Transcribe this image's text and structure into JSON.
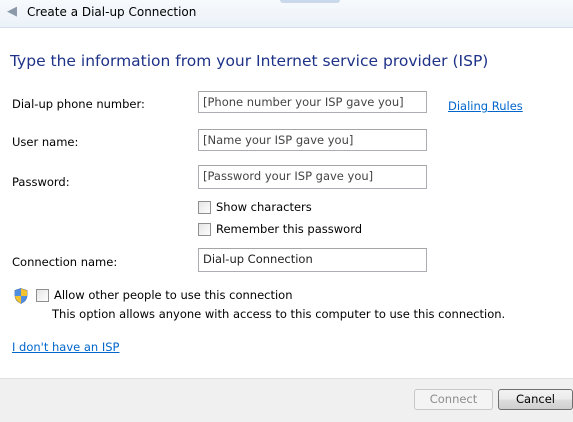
{
  "window": {
    "title": "Create a Dial-up Connection",
    "back_icon": "back-arrow-icon"
  },
  "heading": "Type the information from your Internet service provider (ISP)",
  "form": {
    "phone_label": "Dial-up phone number:",
    "phone_value": "[Phone number your ISP gave you]",
    "dialing_rules_link": "Dialing Rules",
    "user_label": "User name:",
    "user_value": "[Name your ISP gave you]",
    "password_label": "Password:",
    "password_value": "[Password your ISP gave you]",
    "show_characters_label": "Show characters",
    "show_characters_checked": false,
    "remember_password_label": "Remember this password",
    "remember_password_checked": false,
    "connection_name_label": "Connection name:",
    "connection_name_value": "Dial-up Connection",
    "allow_others_label": "Allow other people to use this connection",
    "allow_others_checked": false,
    "allow_others_description": "This option allows anyone with access to this computer to use this connection.",
    "allow_others_icon": "uac-shield-icon",
    "no_isp_link": "I don't have an ISP"
  },
  "buttons": {
    "connect_label": "Connect",
    "connect_enabled": false,
    "cancel_label": "Cancel"
  },
  "colors": {
    "heading": "#1e3287",
    "link": "#0066cc",
    "footer_bg": "#f0f0f0"
  }
}
